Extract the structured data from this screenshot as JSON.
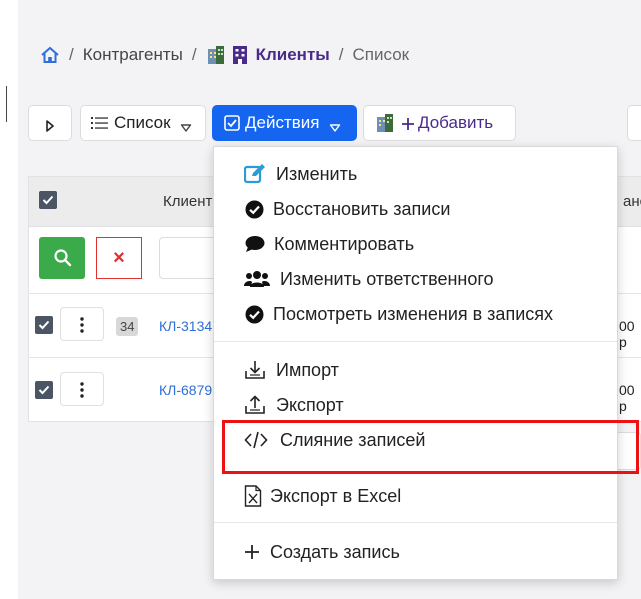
{
  "breadcrumb": {
    "counterparties": "Контрагенты",
    "clients": "Клиенты",
    "list": "Список",
    "separator": "/"
  },
  "toolbar": {
    "list_label": "Список",
    "actions_label": "Действия",
    "add_label": "Добавить"
  },
  "table": {
    "header_client": "Клиент",
    "header_right_partial": "анс",
    "rows": [
      {
        "badge": "34",
        "code": "КЛ-3134",
        "right_partial": "00 р"
      },
      {
        "badge": "",
        "code": "КЛ-6879",
        "right_partial": "00 р"
      }
    ],
    "clear_label": "×"
  },
  "menu": {
    "items": [
      {
        "label": "Изменить",
        "icon": "edit-icon"
      },
      {
        "label": "Восстановить записи",
        "icon": "check-circle-icon"
      },
      {
        "label": "Комментировать",
        "icon": "comment-icon"
      },
      {
        "label": "Изменить ответственного",
        "icon": "users-icon"
      },
      {
        "label": "Посмотреть изменения в записях",
        "icon": "check-circle-icon"
      },
      {
        "label": "Импорт",
        "icon": "import-icon"
      },
      {
        "label": "Экспорт",
        "icon": "export-icon"
      },
      {
        "label": "Слияние записей",
        "icon": "code-icon"
      },
      {
        "label": "Экспорт в Excel",
        "icon": "excel-file-icon"
      },
      {
        "label": "Создать запись",
        "icon": "plus-icon"
      }
    ]
  },
  "colors": {
    "primary": "#1565f0",
    "success": "#3aaa4a",
    "danger": "#ee1111",
    "link": "#2f6fd6",
    "breadcrumb_current": "#4a2a8a"
  }
}
